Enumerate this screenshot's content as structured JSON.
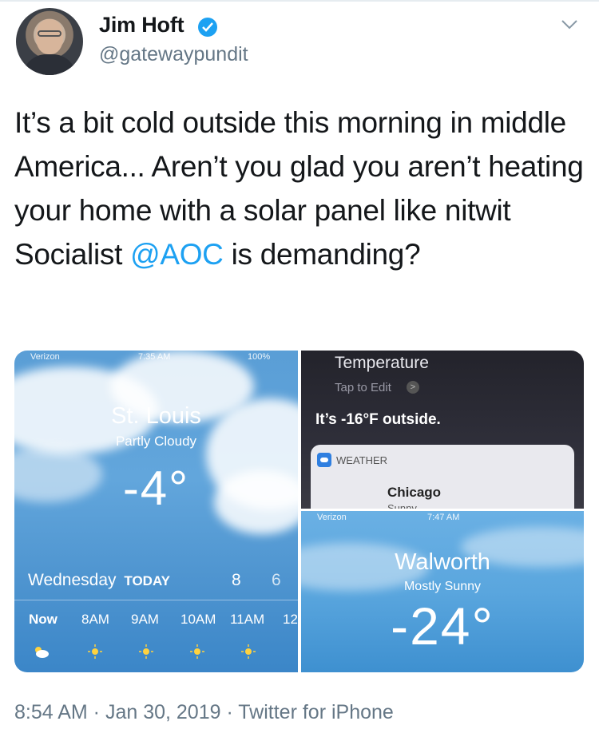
{
  "author": {
    "name": "Jim Hoft",
    "handle": "@gatewaypundit",
    "verified_icon": "verified-badge-icon",
    "menu_icon": "chevron-down-icon"
  },
  "tweet": {
    "text_before": "It’s a bit cold outside this morning in middle America... Aren’t you glad you aren’t heating your home with a solar panel like nitwit Socialist ",
    "mention": "@AOC",
    "text_after": " is demanding?"
  },
  "images": {
    "st_louis": {
      "status_carrier": "Verizon",
      "status_time": "7:35 AM",
      "status_battery": "100%",
      "city": "St. Louis",
      "condition": "Partly Cloudy",
      "temperature": "-4°",
      "day": "Wednesday",
      "today_label": "TODAY",
      "high": "8",
      "low": "6",
      "hours": [
        "Now",
        "8AM",
        "9AM",
        "10AM",
        "11AM",
        "12"
      ]
    },
    "siri": {
      "title": "Temperature",
      "tap_to_edit": "Tap to Edit",
      "chevron": ">",
      "answer": "It’s -16°F outside.",
      "card_label": "WEATHER",
      "card_city": "Chicago",
      "card_condition": "Sunny"
    },
    "walworth": {
      "status_carrier": "Verizon",
      "status_time": "7:47 AM",
      "city": "Walworth",
      "condition": "Mostly Sunny",
      "temperature": "-24°"
    }
  },
  "meta": {
    "timestamp": "8:54 AM · Jan 30, 2019 · Twitter for iPhone"
  },
  "colors": {
    "link": "#1da1f2",
    "secondary_text": "#657786"
  }
}
